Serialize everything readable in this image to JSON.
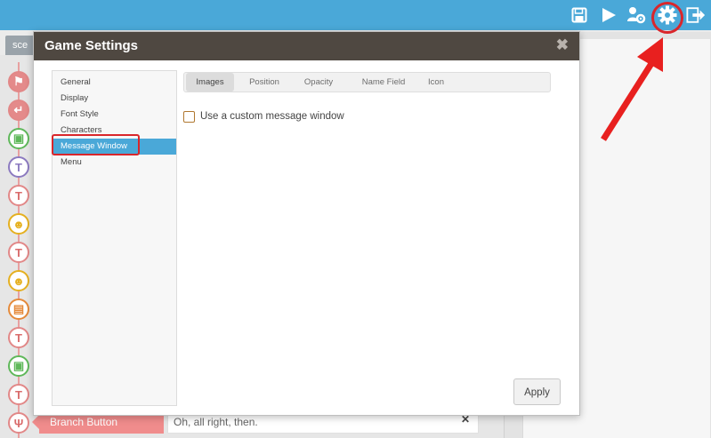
{
  "toolbar": {
    "icons": [
      "save-icon",
      "play-icon",
      "characters-icon",
      "gear-icon",
      "export-icon"
    ]
  },
  "background": {
    "tab_label": "sce",
    "branch": {
      "label": "Branch Button",
      "text": "Oh, all right, then."
    },
    "timeline_nodes": [
      "flag-icon",
      "arrow-icon",
      "image-icon",
      "text-effect-icon",
      "T",
      "character-icon",
      "T",
      "character-move-icon",
      "document-icon",
      "T",
      "image-icon",
      "T",
      "branch-icon"
    ]
  },
  "modal": {
    "title": "Game Settings",
    "close": "✖",
    "sidebar": {
      "items": [
        {
          "label": "General"
        },
        {
          "label": "Display"
        },
        {
          "label": "Font Style"
        },
        {
          "label": "Characters"
        },
        {
          "label": "Message Window"
        },
        {
          "label": "Menu"
        }
      ],
      "active": "Message Window"
    },
    "tabs": [
      {
        "label": "Images"
      },
      {
        "label": "Position"
      },
      {
        "label": "Opacity"
      },
      {
        "label": "Name Field"
      },
      {
        "label": "Icon"
      }
    ],
    "active_tab": "Images",
    "checkbox": {
      "label": "Use a custom message window",
      "checked": false
    },
    "apply_label": "Apply"
  },
  "colors": {
    "topbar": "#4aa8d8",
    "modal_header": "#4f4841",
    "highlight": "#d9262b",
    "active_item": "#4aa8d8"
  }
}
